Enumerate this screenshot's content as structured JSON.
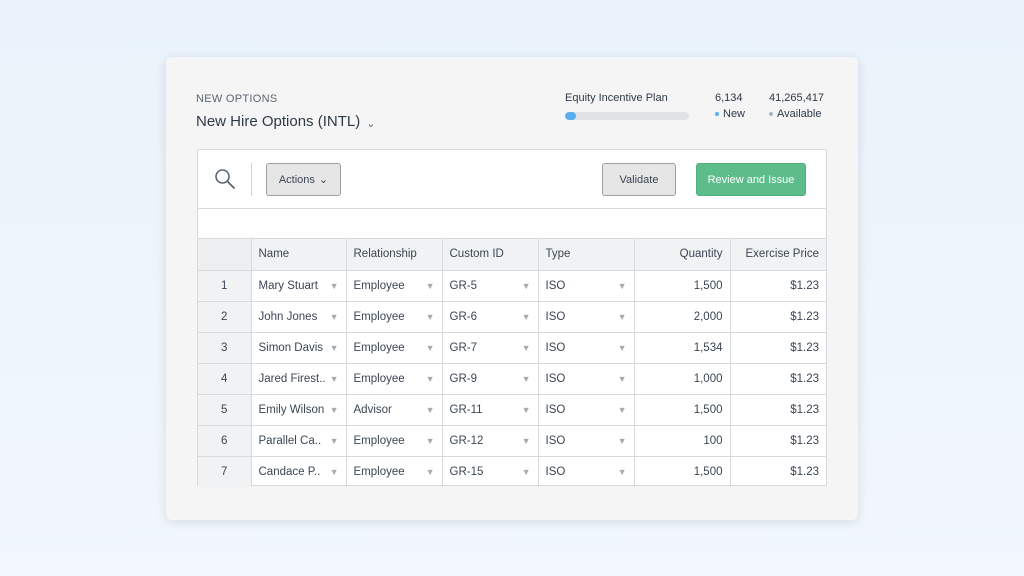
{
  "header": {
    "section_label": "NEW OPTIONS",
    "title": "New Hire Options (INTL)",
    "chevron_glyph": "⌄"
  },
  "plan": {
    "name": "Equity Incentive Plan",
    "usage_fraction": 0.09,
    "bar_color": "#5aaef0"
  },
  "stats": {
    "new_value": "6,134",
    "new_label": "New",
    "new_dot_color": "#5aaef0",
    "available_value": "41,265,417",
    "available_label": "Available",
    "available_dot_color": "#b0b5ba"
  },
  "toolbar": {
    "search_icon": "search-icon",
    "actions_label": "Actions",
    "actions_chevron": "⌄",
    "validate_label": "Validate",
    "review_label": "Review and Issue",
    "review_color": "#5cbd8b"
  },
  "table": {
    "columns": [
      "Name",
      "Relationship",
      "Custom ID",
      "Type",
      "Quantity",
      "Exercise Price"
    ],
    "dropdown_glyph": "▼",
    "rows": [
      {
        "index": "1",
        "name": "Mary Stuart",
        "relationship": "Employee",
        "custom_id": "GR-5",
        "type": "ISO",
        "quantity": "1,500",
        "price": "$1.23"
      },
      {
        "index": "2",
        "name": "John Jones",
        "relationship": "Employee",
        "custom_id": "GR-6",
        "type": "ISO",
        "quantity": "2,000",
        "price": "$1.23"
      },
      {
        "index": "3",
        "name": "Simon Davis",
        "relationship": "Employee",
        "custom_id": "GR-7",
        "type": "ISO",
        "quantity": "1,534",
        "price": "$1.23"
      },
      {
        "index": "4",
        "name": "Jared Firest..",
        "relationship": "Employee",
        "custom_id": "GR-9",
        "type": "ISO",
        "quantity": "1,000",
        "price": "$1.23"
      },
      {
        "index": "5",
        "name": "Emily Wilson",
        "relationship": "Advisor",
        "custom_id": "GR-11",
        "type": "ISO",
        "quantity": "1,500",
        "price": "$1.23"
      },
      {
        "index": "6",
        "name": "Parallel Ca..",
        "relationship": "Employee",
        "custom_id": "GR-12",
        "type": "ISO",
        "quantity": "100",
        "price": "$1.23"
      },
      {
        "index": "7",
        "name": "Candace P..",
        "relationship": "Employee",
        "custom_id": "GR-15",
        "type": "ISO",
        "quantity": "1,500",
        "price": "$1.23"
      }
    ]
  }
}
